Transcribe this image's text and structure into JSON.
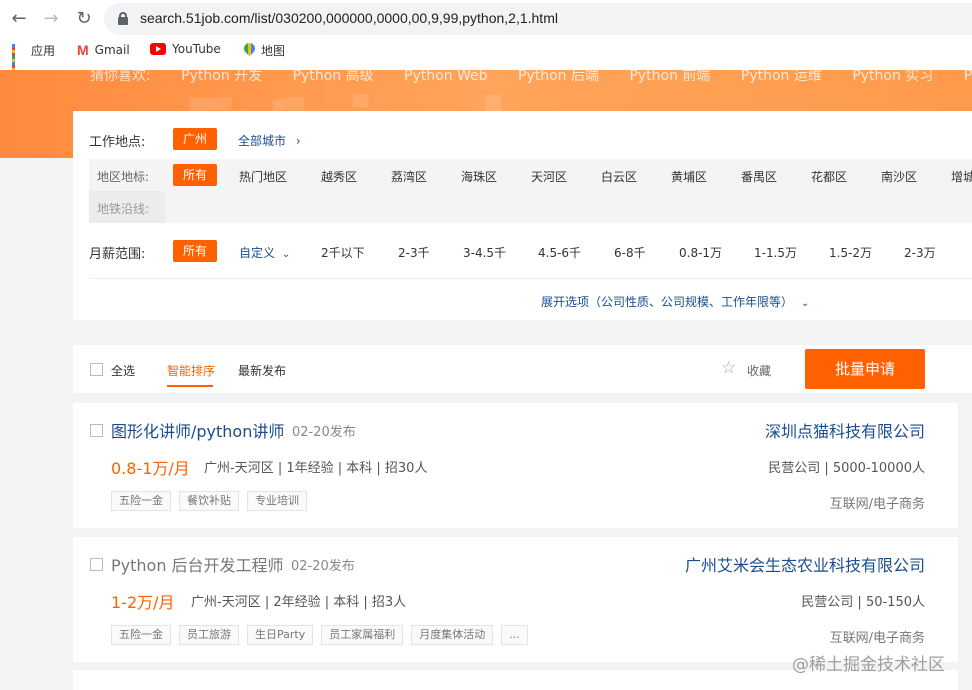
{
  "browser": {
    "url": "search.51job.com/list/030200,000000,0000,00,9,99,python,2,1.html",
    "bookmarks": [
      {
        "label": "应用",
        "icon": "apps-icon"
      },
      {
        "label": "Gmail",
        "icon": "gmail-icon"
      },
      {
        "label": "YouTube",
        "icon": "youtube-icon"
      },
      {
        "label": "地图",
        "icon": "maps-icon"
      }
    ]
  },
  "banner": {
    "guess_label": "猜你喜欢:",
    "guess_items": [
      "Python 开发",
      "Python 高级",
      "Python Web",
      "Python 后端",
      "Python 前端",
      "Python 运维",
      "Python 实习",
      "Python 自"
    ]
  },
  "filter": {
    "location_label": "工作地点:",
    "location_selected": "广州",
    "all_cities": "全部城市",
    "district_label": "地区地标:",
    "metro_label": "地铁沿线:",
    "district_selected": "所有",
    "districts": [
      "热门地区",
      "越秀区",
      "荔湾区",
      "海珠区",
      "天河区",
      "白云区",
      "黄埔区",
      "番禺区",
      "花都区",
      "南沙区",
      "增城"
    ],
    "salary_label": "月薪范围:",
    "salary_selected": "所有",
    "salary_custom": "自定义",
    "salaries": [
      "2千以下",
      "2-3千",
      "3-4.5千",
      "4.5-6千",
      "6-8千",
      "0.8-1万",
      "1-1.5万",
      "1.5-2万",
      "2-3万"
    ],
    "expand": "展开选项（公司性质、公司规模、工作年限等）"
  },
  "toolbar": {
    "select_all": "全选",
    "sort_smart": "智能排序",
    "sort_latest": "最新发布",
    "favorite": "收藏",
    "batch_apply": "批量申请"
  },
  "jobs": [
    {
      "title": "图形化讲师/python讲师",
      "date": "02-20发布",
      "company": "深圳点猫科技有限公司",
      "salary": "0.8-1万/月",
      "meta": "广州-天河区 | 1年经验 | 本科 | 招30人",
      "company_meta": "民营公司 | 5000-10000人",
      "tags": [
        "五险一金",
        "餐饮补贴",
        "专业培训"
      ],
      "industry": "互联网/电子商务"
    },
    {
      "title": "Python 后台开发工程师",
      "date": "02-20发布",
      "company": "广州艾米会生态农业科技有限公司",
      "salary": "1-2万/月",
      "meta": "广州-天河区 | 2年经验 | 本科 | 招3人",
      "company_meta": "民营公司 | 50-150人",
      "tags": [
        "五险一金",
        "员工旅游",
        "生日Party",
        "员工家属福利",
        "月度集体活动",
        "..."
      ],
      "industry": "互联网/电子商务"
    }
  ],
  "watermark": "@稀土掘金技术社区"
}
